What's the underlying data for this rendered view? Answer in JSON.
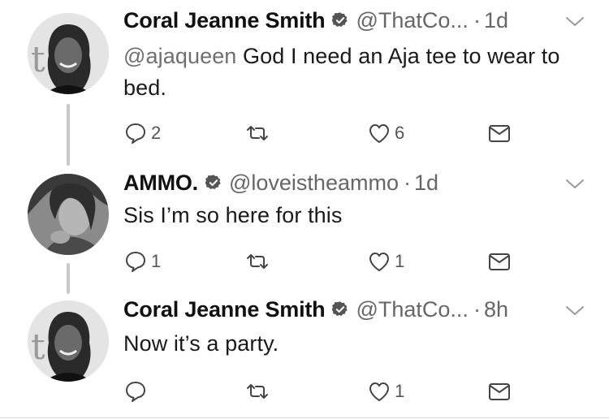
{
  "tweets": [
    {
      "name": "Coral Jeanne Smith",
      "handle": "@ThatCo...",
      "sep": "·",
      "time": "1d",
      "mention": "@ajaqueen",
      "text_after_mention": " God I need an Aja tee to wear to bed.",
      "replies": "2",
      "retweets": "",
      "likes": "6"
    },
    {
      "name": "AMMO.",
      "handle": "@loveistheammo",
      "sep": "·",
      "time": "1d",
      "mention": "",
      "text_after_mention": "Sis I’m so here for this",
      "replies": "1",
      "retweets": "",
      "likes": "1"
    },
    {
      "name": "Coral Jeanne Smith",
      "handle": "@ThatCo...",
      "sep": "·",
      "time": "8h",
      "mention": "",
      "text_after_mention": "Now it’s a party.",
      "replies": "",
      "retweets": "",
      "likes": "1"
    }
  ],
  "icons": {
    "verified": "verified-badge-icon",
    "menu": "chevron-down-icon",
    "reply": "reply-icon",
    "retweet": "retweet-icon",
    "like": "heart-icon",
    "dm": "envelope-icon"
  },
  "colors": {
    "name": "#111111",
    "secondary": "#666666",
    "thread_line": "#c9c9c9"
  }
}
